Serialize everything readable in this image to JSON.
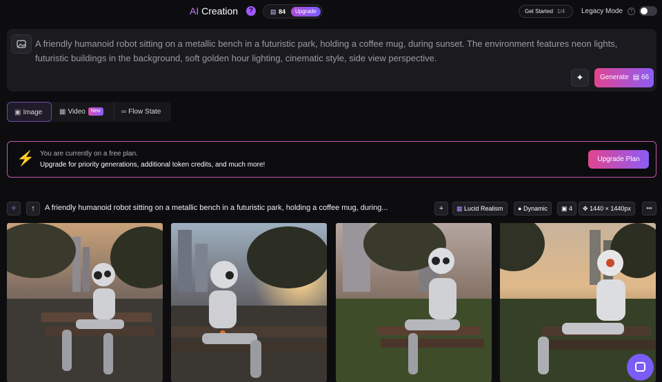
{
  "header": {
    "title_ai": "AI",
    "title_rest": " Creation",
    "help_glyph": "?",
    "token_count": "84",
    "upgrade_label": "Upgrade",
    "get_started_label": "Get Started",
    "get_started_step": "1/4",
    "legacy_mode_label": "Legacy Mode",
    "legacy_mode_enabled": false
  },
  "prompt": {
    "text": "A friendly humanoid robot sitting on a metallic bench in a futuristic park, holding a coffee mug, during sunset. The environment features neon lights, futuristic buildings in the background, soft golden hour lighting, cinematic style, side view perspective.",
    "generate_label": "Generate",
    "generate_cost": "66"
  },
  "tabs": [
    {
      "label": "Image",
      "active": true
    },
    {
      "label": "Video",
      "badge": "New"
    },
    {
      "label": "Flow State"
    }
  ],
  "banner": {
    "line1": "You are currently on a free plan.",
    "line2": "Upgrade for priority generations, additional token credits, and much more!",
    "button": "Upgrade Plan"
  },
  "generation": {
    "prompt_preview": "A friendly humanoid robot sitting on a metallic bench in a futuristic park, holding a coffee mug, during...",
    "model": "Lucid Realism",
    "style": "Dynamic",
    "count": "4",
    "size": "1440 × 1440px",
    "more": "•••"
  },
  "icons": {
    "attach": "image-upload-icon",
    "magic": "sparkle-icon",
    "token": "token-icon",
    "bolt": "lightning-icon",
    "chat": "chat-icon"
  },
  "colors": {
    "accent_pink": "#e2458f",
    "accent_purple": "#8c5cf6",
    "banner_border": "#c55aa8"
  }
}
